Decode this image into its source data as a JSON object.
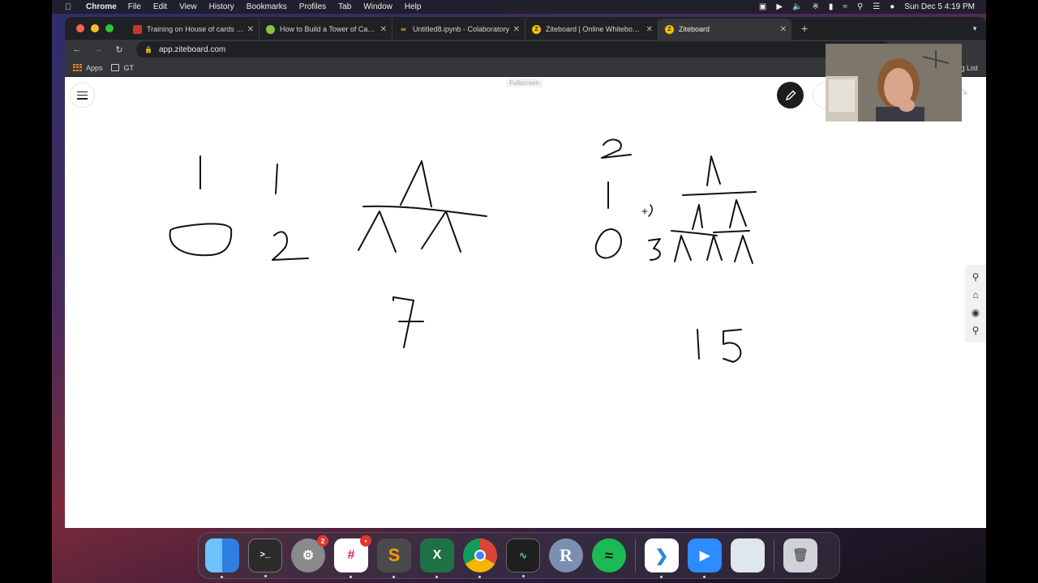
{
  "menubar": {
    "app_name": "Chrome",
    "menus": [
      "File",
      "Edit",
      "View",
      "History",
      "Bookmarks",
      "Profiles",
      "Tab",
      "Window",
      "Help"
    ],
    "clock": "Sun Dec 5  4:19 PM"
  },
  "tabs": [
    {
      "title": "Training on House of cards | Co",
      "favicon_color": "#c0392b",
      "active": false
    },
    {
      "title": "How to Build a Tower of Cards",
      "favicon_color": "#8bc34a",
      "active": false
    },
    {
      "title": "Untitled8.ipynb - Colaboratory",
      "favicon_color": "#f9a825",
      "active": false
    },
    {
      "title": "Ziteboard | Online Whiteboard",
      "favicon_color": "#f2c400",
      "active": false
    },
    {
      "title": "Ziteboard",
      "favicon_color": "#f2c400",
      "active": true
    }
  ],
  "toolbar": {
    "url": "app.ziteboard.com"
  },
  "bookmarks": {
    "items": [
      "Apps",
      "GT"
    ],
    "reading_list": "g List"
  },
  "board": {
    "fullscreen_label": "Fullscreen",
    "handwriting": {
      "left_rows": [
        "1",
        "1"
      ],
      "left_row_b": [
        "0",
        "2"
      ],
      "left_total": "7",
      "right_levels": [
        "2",
        "1",
        "0"
      ],
      "right_three": "3",
      "right_total": "15"
    }
  },
  "dock": {
    "apps": [
      {
        "name": "Finder",
        "color": "#3b8ff0"
      },
      {
        "name": "Terminal",
        "color": "#2b2b2b"
      },
      {
        "name": "System Preferences",
        "color": "#8a8a8a",
        "badge": "2"
      },
      {
        "name": "Slack",
        "color": "#ffffff",
        "badge": "•"
      },
      {
        "name": "Sublime Text",
        "color": "#4a4a4a"
      },
      {
        "name": "Excel",
        "color": "#1e7145"
      },
      {
        "name": "Chrome",
        "color": "#ffffff"
      },
      {
        "name": "Activity Monitor",
        "color": "#1f1f1f"
      },
      {
        "name": "R",
        "color": "#7b8fb0"
      },
      {
        "name": "Spotify",
        "color": "#1db954"
      },
      {
        "name": "VS Code",
        "color": "#ffffff"
      },
      {
        "name": "Zoom",
        "color": "#2d8cff"
      },
      {
        "name": "Preview",
        "color": "#dfe6ee"
      },
      {
        "name": "Trash",
        "color": "#cfd3d8"
      }
    ]
  }
}
